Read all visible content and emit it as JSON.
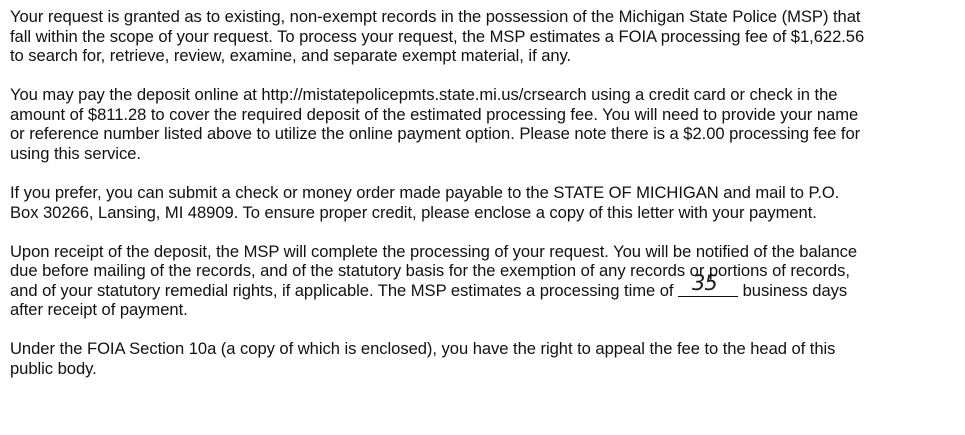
{
  "paragraphs": [
    {
      "lines": [
        "Your request is granted as to existing, non-exempt records in the possession of the Michigan State Police (MSP) that",
        "fall within the scope of your request. To process your request, the MSP estimates a FOIA processing fee of $1,622.56",
        "to search for, retrieve, review, examine, and separate exempt material, if any."
      ]
    },
    {
      "lines": [
        "You may pay the deposit online at http://mistatepolicepmts.state.mi.us/crsearch using a credit card or check in the",
        "amount of $811.28 to cover the required deposit of the estimated processing fee. You will need to provide your name",
        "or reference number listed above to utilize the online payment option. Please note there is a $2.00 processing fee for",
        "using this service."
      ]
    },
    {
      "lines": [
        "If you prefer, you can submit a check or money order made payable to the STATE OF MICHIGAN and mail to P.O.",
        "Box 30266, Lansing, MI 48909. To ensure proper credit, please enclose a copy of this letter with your payment."
      ]
    },
    {
      "lines": [
        "Upon receipt of the deposit, the MSP will complete the processing of your request. You will be notified of the balance",
        "due before mailing of the records, and of the statutory basis for the exemption of any records or portions of records,"
      ],
      "line3_before": "and of your statutory remedial rights, if applicable. The MSP estimates a processing time of",
      "days_handwritten": "35",
      "line3_after": "business days",
      "line4": "after receipt of payment."
    },
    {
      "lines": [
        "Under the FOIA Section 10a (a copy of which is enclosed), you have the right to appeal the fee to the head of this",
        "public body."
      ]
    }
  ]
}
